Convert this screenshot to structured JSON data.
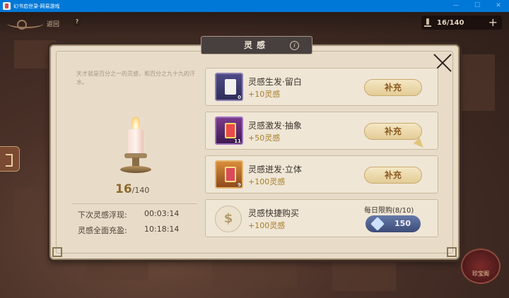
{
  "window": {
    "title": "幻书启世录-网易游戏",
    "minimize": "—",
    "maximize": "☐",
    "close": "✕"
  },
  "hud": {
    "return_label": "返回",
    "help": "?",
    "counter_value": "16/140",
    "counter_plus": "+",
    "treasure_label": "珍宝阁"
  },
  "dialog": {
    "title": "灵感",
    "info": "i",
    "quote": "天才就是百分之一的灵感，和百分之九十九的汗水。",
    "stock": {
      "current": "16",
      "max": "/140"
    },
    "timers": [
      {
        "label": "下次灵感浮现:",
        "time": "00:03:14"
      },
      {
        "label": "灵感全面充盈:",
        "time": "10:18:14"
      }
    ],
    "items": [
      {
        "name": "灵感生发·留白",
        "gain": "+10灵感",
        "count": "0",
        "button": "补充"
      },
      {
        "name": "灵感激发·抽象",
        "gain": "+50灵感",
        "count": "11",
        "button": "补充"
      },
      {
        "name": "灵感迸发·立体",
        "gain": "+100灵感",
        "count": "9",
        "button": "补充"
      },
      {
        "name": "灵感快捷购买",
        "gain": "+100灵感",
        "coin": "$",
        "limit": "每日限购(8/10)",
        "price": "150"
      }
    ]
  },
  "colors": {
    "accent_gold": "#a77c2a",
    "title_bar": "#0078d7",
    "dialog_bg": "#e8dcc9"
  }
}
